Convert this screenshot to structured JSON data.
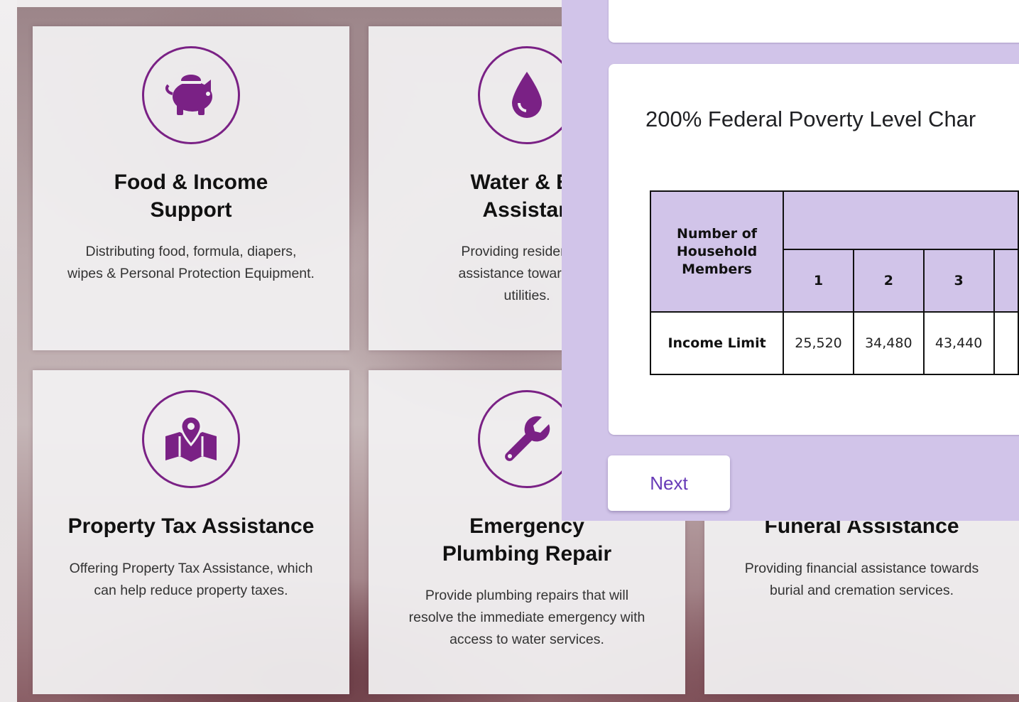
{
  "colors": {
    "accent_purple": "#7a2185",
    "form_panel": "#d1c4e9",
    "button_text": "#673ab7"
  },
  "cards": [
    {
      "icon": "piggy-bank-icon",
      "title_line1": "Food & Income",
      "title_line2": "Support",
      "desc_lines": [
        "Distributing food, formula, diapers,",
        "wipes & Personal Protection Equipment."
      ]
    },
    {
      "icon": "water-drop-icon",
      "title_line1": "Water & En",
      "title_line2": "Assistan",
      "desc_lines": [
        "Providing residents w",
        "assistance towards en",
        "utilities."
      ]
    },
    {
      "icon": "map-pin-icon",
      "title_line1": "Property Tax Assistance",
      "desc_lines": [
        "Offering Property Tax Assistance, which",
        "can help reduce property taxes."
      ]
    },
    {
      "icon": "wrench-icon",
      "title_line1": "Emergency",
      "title_line2": "Plumbing Repair",
      "desc_lines": [
        "Provide plumbing repairs that will",
        "resolve the immediate emergency with",
        "access to water services."
      ]
    },
    {
      "icon": "",
      "title_line1": "Funeral Assistance",
      "desc_lines": [
        "Providing financial assistance towards",
        "burial and cremation services."
      ]
    }
  ],
  "form": {
    "chart_title": "200% Federal Poverty Level Char",
    "table": {
      "row_header": "Number of Household Members",
      "columns": [
        "1",
        "2",
        "3"
      ],
      "income_label": "Income Limit",
      "income_values": [
        "25,520",
        "34,480",
        "43,440"
      ]
    },
    "next_label": "Next"
  }
}
